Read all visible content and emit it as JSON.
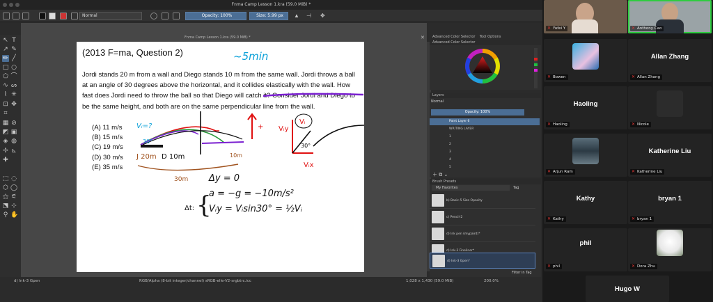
{
  "krita": {
    "window_title": "Fnma Camp Lesson 1.kra (59.0 MiB) *",
    "doc_tab_title": "Fnma Camp Lesson 1.kra (59.0 MiB) *",
    "blend_mode": "Normal",
    "opacity_label": "Opacity: 100%",
    "size_label": "Size: 5.99 px",
    "page": {
      "title": "(2013 F=ma, Question 2)",
      "timer_note": "~5min",
      "problem_text": "Jordi stands 20 m from a wall and Diego stands 10 m from the same wall. Jordi throws a ball at an angle of 30 degrees above the horizontal, and it collides elastically with the wall. How fast does Jordi need to throw the ball so that Diego will catch it? Consider Jordi and Diego to be the same height, and both are on the same perpendicular line from the wall.",
      "choices": [
        "(A) 11 m/s",
        "(B) 15 m/s",
        "(C) 19 m/s",
        "(D) 30 m/s",
        "(E) 35 m/s"
      ]
    },
    "status": {
      "brush": "d) Ink-3 Gpen",
      "color_model": "RGB/Alpha (8-bit integer/channel)  sRGB-elle-V2-srgbtrc.icc",
      "dims": "1,028 x 1,430 (59.0 MiB)",
      "zoom": "200.0%"
    },
    "dockers": {
      "tab1": "Advanced Color Selector",
      "tab2": "Tool Options",
      "color_header": "Advanced Color Selector",
      "layers_header": "Layers",
      "layers_blend": "Normal",
      "layers_opacity": "Opacity:  100%",
      "layers": [
        "Paint Layer 6",
        "WRITING LAYER",
        "1",
        "2",
        "3",
        "4",
        "5"
      ],
      "brush_header": "Brush Presets",
      "favorites": "My Favorites",
      "tag": "Tag",
      "brushes": [
        "b) Basic-5 Size Opacity",
        "c) Pencil-2",
        "d) Ink pen (mypaint)*",
        "d) Ink-2 Fineliner*",
        "d) Ink-3 Gpen*"
      ],
      "filter_label": "Filter in Tag"
    }
  },
  "zoom": {
    "participants": [
      {
        "name": "Yufei Y",
        "tag": "Yufei Y",
        "type": "video"
      },
      {
        "name": "Anthony Cao",
        "tag": "Anthony Cao",
        "type": "video"
      },
      {
        "name": "Bowen",
        "tag": "Bowen",
        "type": "avatar"
      },
      {
        "name": "Allan Zhang",
        "tag": "Allan Zhang",
        "type": "name"
      },
      {
        "name": "Haoling",
        "tag": "Haoling",
        "type": "name"
      },
      {
        "name": "Nicole",
        "tag": "Nicole",
        "type": "avatar"
      },
      {
        "name": "Arjun Ram",
        "tag": "Arjun Ram",
        "type": "avatar"
      },
      {
        "name": "Katherine Liu",
        "tag": "Katherine Liu",
        "type": "name"
      },
      {
        "name": "Kathy",
        "tag": "Kathy",
        "type": "name"
      },
      {
        "name": "bryan 1",
        "tag": "bryan 1",
        "type": "name"
      },
      {
        "name": "phil",
        "tag": "phil",
        "type": "name"
      },
      {
        "name": "Dora Zhu",
        "tag": "Dora Zhu",
        "type": "avatar"
      },
      {
        "name": "Hugo W",
        "tag": "",
        "type": "name"
      }
    ]
  },
  "colors": {
    "accent": "#4b6e95",
    "speaking": "#2ecc40",
    "ink_blue": "#0aa0d8",
    "ink_red": "#e01010",
    "ink_purple": "#7a1fd0",
    "ink_brown": "#a0521e",
    "ink_green": "#2c9a3c"
  }
}
